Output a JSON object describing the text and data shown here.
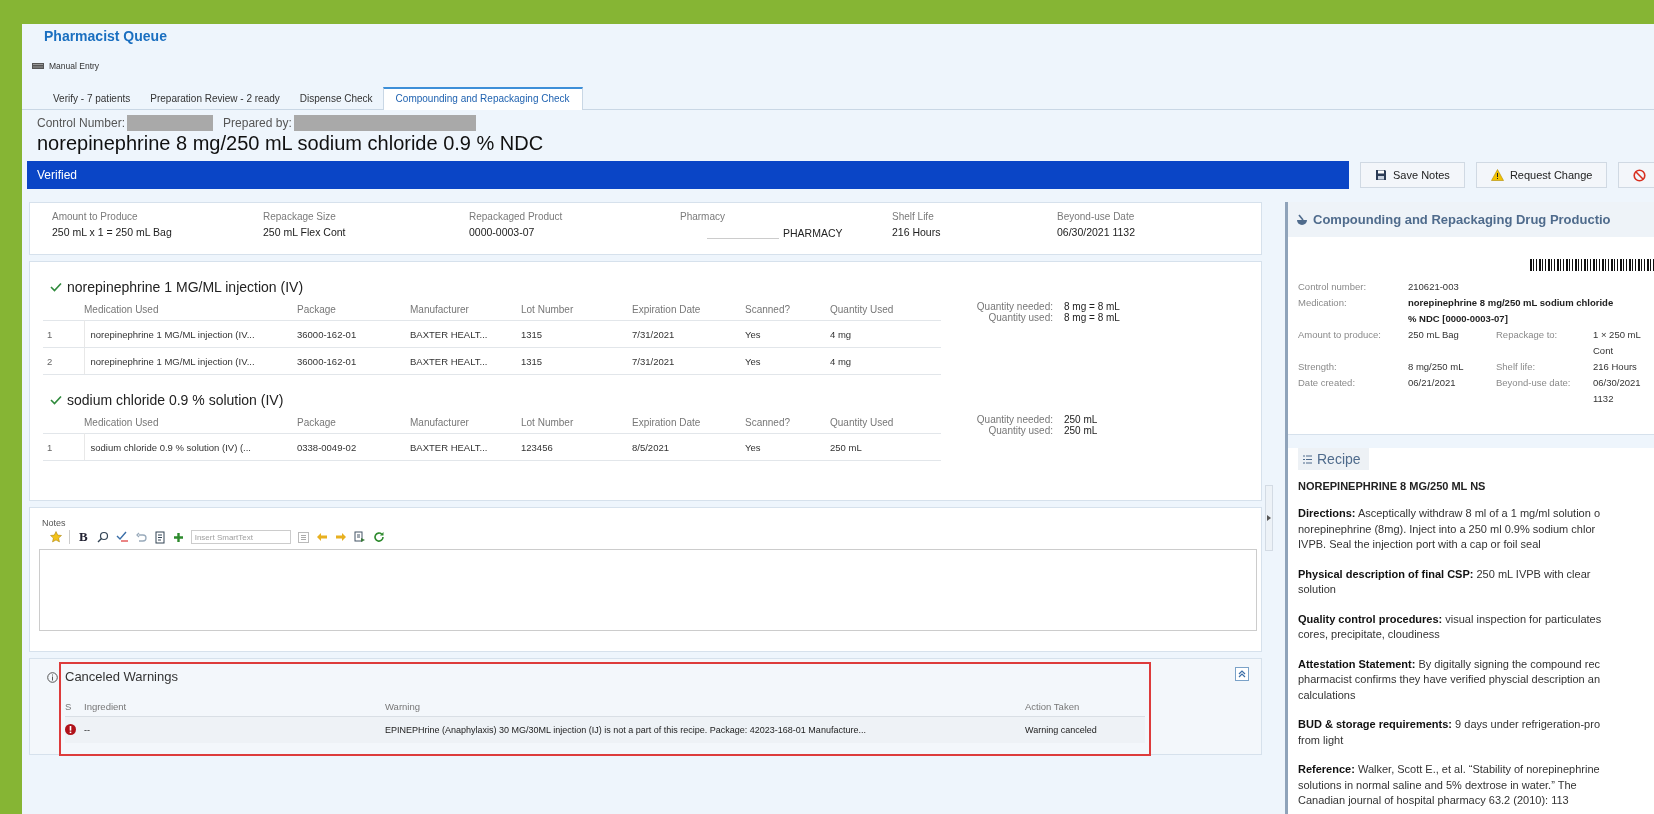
{
  "app_title": "Pharmacist Queue",
  "manual_entry": "Manual Entry",
  "tabs": [
    {
      "label": "Verify - 7 patients",
      "selected": false
    },
    {
      "label": "Preparation Review - 2 ready",
      "selected": false
    },
    {
      "label": "Dispense Check",
      "selected": false
    },
    {
      "label": "Compounding and Repackaging Check",
      "selected": true
    }
  ],
  "control_number_label": "Control Number:",
  "prepared_by_label": "Prepared by:",
  "product_title": "norepinephrine 8 mg/250 mL sodium chloride 0.9 % NDC",
  "status": "Verified",
  "actions": [
    {
      "kind": "labeled",
      "label": "Save Notes"
    },
    {
      "kind": "labeled",
      "label": "Request Change"
    },
    {
      "kind": "icon-only"
    }
  ],
  "summary": [
    {
      "label": "Amount to Produce",
      "value": "250 mL x 1 = 250 mL Bag"
    },
    {
      "label": "Repackage Size",
      "value": "250 mL Flex Cont"
    },
    {
      "label": "Repackaged Product",
      "value": "0000-0003-07"
    },
    {
      "label": "Pharmacy",
      "value": "PHARMACY",
      "redacted": true
    },
    {
      "label": "Shelf Life",
      "value": "216 Hours"
    },
    {
      "label": "Beyond-use Date",
      "value": "06/30/2021 1132"
    }
  ],
  "ingredients": [
    {
      "name": "norepinephrine 1 MG/ML injection (IV)",
      "verified": true,
      "columns": [
        "",
        "Medication Used",
        "Package",
        "Manufacturer",
        "Lot Number",
        "Expiration Date",
        "Scanned?",
        "Quantity Used"
      ],
      "rows": [
        [
          "1",
          "norepinephrine 1 MG/ML injection (IV...",
          "36000-162-01",
          "BAXTER HEALT...",
          "1315",
          "7/31/2021",
          "Yes",
          "4 mg"
        ],
        [
          "2",
          "norepinephrine 1 MG/ML injection (IV...",
          "36000-162-01",
          "BAXTER HEALT...",
          "1315",
          "7/31/2021",
          "Yes",
          "4 mg"
        ]
      ],
      "totals": [
        {
          "label": "Quantity needed:",
          "value": "8 mg = 8 mL"
        },
        {
          "label": "Quantity used:",
          "value": "8 mg = 8 mL"
        }
      ]
    },
    {
      "name": "sodium chloride 0.9 % solution (IV)",
      "verified": true,
      "columns": [
        "",
        "Medication Used",
        "Package",
        "Manufacturer",
        "Lot Number",
        "Expiration Date",
        "Scanned?",
        "Quantity Used"
      ],
      "rows": [
        [
          "1",
          "sodium chloride 0.9 % solution (IV) (...",
          "0338-0049-02",
          "BAXTER HEALT...",
          "123456",
          "8/5/2021",
          "Yes",
          "250 mL"
        ]
      ],
      "totals": [
        {
          "label": "Quantity needed:",
          "value": "250 mL"
        },
        {
          "label": "Quantity used:",
          "value": "250 mL"
        }
      ]
    }
  ],
  "notes": {
    "label": "Notes",
    "bold_tool": "B",
    "smarttext_placeholder": "Insert SmartText"
  },
  "canceled_warnings": {
    "title": "Canceled Warnings",
    "columns": [
      "S",
      "Ingredient",
      "Warning",
      "Action Taken"
    ],
    "rows": [
      {
        "ingredient": "--",
        "warning": "EPINEPHrine (Anaphylaxis) 30 MG/30ML injection (IJ) is not a part of this recipe. Package: 42023-168-01 Manufacture...",
        "action": "Warning canceled"
      }
    ]
  },
  "production": {
    "title": "Compounding and Repackaging Drug Productio",
    "details": [
      {
        "kind": "wide",
        "label": "Control number:",
        "value": [
          "210621-003"
        ]
      },
      {
        "kind": "emphasis",
        "label": "Medication:",
        "value": [
          "norepinephrine 8 mg/250 mL sodium chloride",
          "% NDC [0000-0003-07]"
        ]
      },
      {
        "kind": "pair",
        "label": "Amount to produce:",
        "value": [
          "250 mL Bag"
        ]
      },
      {
        "kind": "pair",
        "label": "Repackage to:",
        "value": [
          "1 × 250 mL",
          "Cont"
        ]
      },
      {
        "kind": "pair",
        "label": "Strength:",
        "value": [
          "8 mg/250 mL"
        ]
      },
      {
        "kind": "pair",
        "label": "Shelf life:",
        "value": [
          "216 Hours"
        ]
      },
      {
        "kind": "pair",
        "label": "Date created:",
        "value": [
          "06/21/2021"
        ]
      },
      {
        "kind": "pair",
        "label": "Beyond-use date:",
        "value": [
          "06/30/2021",
          "1132"
        ]
      }
    ]
  },
  "recipe": {
    "title": "Recipe",
    "heading": "NOREPINEPHRINE 8 MG/250 ML NS",
    "paragraphs": [
      [
        "**Directions:** Asceptically withdraw 8 ml of a 1 mg/ml solution o",
        "norepinephrine (8mg). Inject into a 250 ml 0.9% sodium chlor",
        "IVPB. Seal the injection port with a cap or foil seal"
      ],
      [
        "**Physical description of final CSP:** 250 mL IVPB with clear",
        "solution"
      ],
      [
        "**Quality control procedures:** visual inspection for particulates",
        "cores, precipitate, cloudiness"
      ],
      [
        "**Attestation Statement:** By digitally signing the compound rec",
        "pharmacist confirms they have verified physcial description an",
        "calculations"
      ],
      [
        "**BUD & storage requirements:** 9 days under refrigeration-pro",
        "from light"
      ],
      [
        "**Reference:** Walker, Scott E., et al. “Stability of norepinephrine",
        "solutions in normal saline and 5% dextrose in water.” The",
        "Canadian journal of hospital pharmacy 63.2 (2010): 113"
      ]
    ]
  }
}
